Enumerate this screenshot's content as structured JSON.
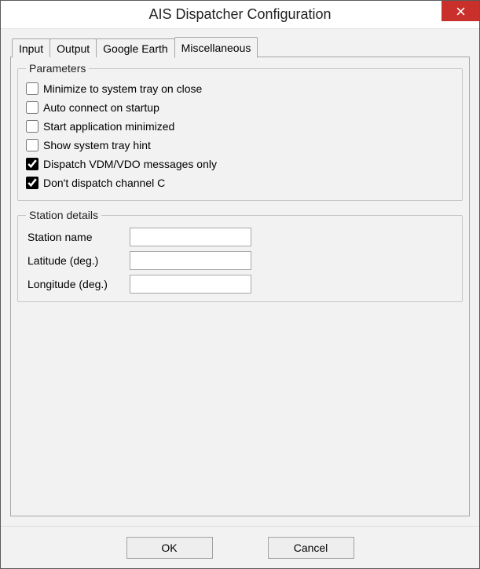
{
  "window": {
    "title": "AIS Dispatcher Configuration"
  },
  "tabs": {
    "input": {
      "label": "Input",
      "active": false
    },
    "output": {
      "label": "Output",
      "active": false
    },
    "google_earth": {
      "label": "Google Earth",
      "active": false
    },
    "misc": {
      "label": "Miscellaneous",
      "active": true
    }
  },
  "parameters": {
    "legend": "Parameters",
    "minimize_tray": {
      "label": "Minimize to system tray on close",
      "checked": false
    },
    "auto_connect": {
      "label": "Auto connect on startup",
      "checked": false
    },
    "start_min": {
      "label": "Start application minimized",
      "checked": false
    },
    "tray_hint": {
      "label": "Show system tray hint",
      "checked": false
    },
    "vdm_only": {
      "label": "Dispatch VDM/VDO messages only",
      "checked": true
    },
    "no_channel_c": {
      "label": "Don't dispatch channel C",
      "checked": true
    }
  },
  "station": {
    "legend": "Station details",
    "name": {
      "label": "Station name",
      "value": ""
    },
    "lat": {
      "label": "Latitude (deg.)",
      "value": ""
    },
    "lon": {
      "label": "Longitude (deg.)",
      "value": ""
    }
  },
  "buttons": {
    "ok": "OK",
    "cancel": "Cancel"
  }
}
